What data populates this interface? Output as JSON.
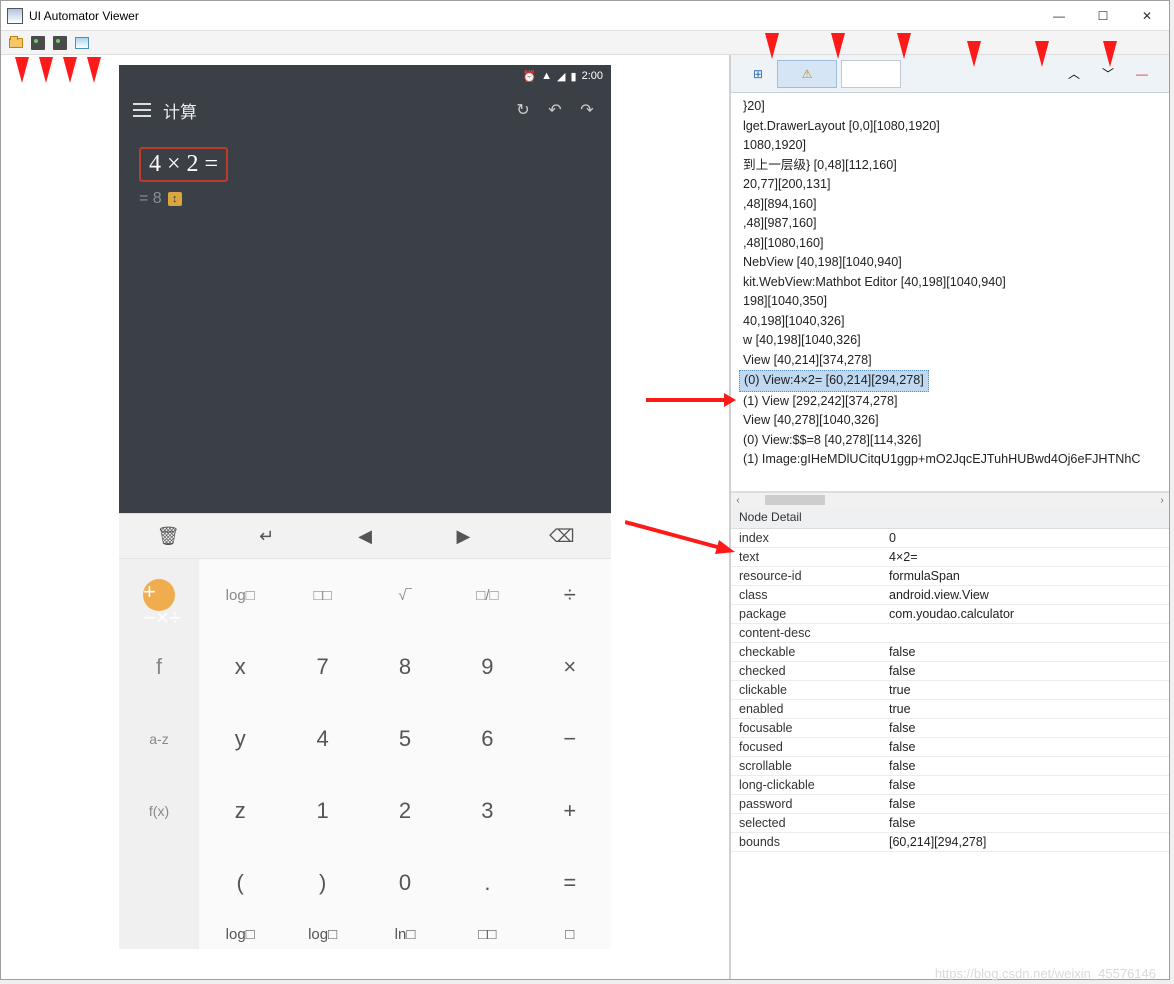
{
  "window": {
    "title": "UI Automator Viewer"
  },
  "status_bar": {
    "time": "2:00"
  },
  "action_bar": {
    "title": "计算"
  },
  "expression": {
    "main": "4 × 2 =",
    "result": "= 8",
    "badge": "↕"
  },
  "fn_row": {
    "trash": "🗑",
    "enter": "↵",
    "left": "◀",
    "right": "▶",
    "back": "⌫"
  },
  "keypad": {
    "r0": {
      "side": "",
      "k1": "log□",
      "k2": "□□",
      "k3": "√‾",
      "k4": "□/□",
      "k5": "÷"
    },
    "r1": {
      "side": "f",
      "k1": "x",
      "k2": "7",
      "k3": "8",
      "k4": "9",
      "k5": "×"
    },
    "r2": {
      "side": "a-z",
      "k1": "y",
      "k2": "4",
      "k3": "5",
      "k4": "6",
      "k5": "−"
    },
    "r3": {
      "side": "f(x)",
      "k1": "z",
      "k2": "1",
      "k3": "2",
      "k4": "3",
      "k5": "+"
    },
    "r4": {
      "side": "",
      "k1": "(",
      "k2": ")",
      "k3": "0",
      "k4": ".",
      "k5": "="
    },
    "r5": {
      "side": "",
      "k1": "log□",
      "k2": "log□",
      "k3": "ln□",
      "k4": "□□",
      "k5": "□"
    }
  },
  "tree_toolbar": {
    "expand": "⊞",
    "flag": "⚠",
    "blank": " ",
    "up": "︿",
    "down": "﹀",
    "minus": "—"
  },
  "tree": [
    "}20]",
    "lget.DrawerLayout [0,0][1080,1920]",
    "1080,1920]",
    "到上一层级} [0,48][112,160]",
    "20,77][200,131]",
    ",48][894,160]",
    ",48][987,160]",
    ",48][1080,160]",
    "NebView [40,198][1040,940]",
    "kit.WebView:Mathbot Editor [40,198][1040,940]",
    "198][1040,350]",
    "40,198][1040,326]",
    "w [40,198][1040,326]",
    "View [40,214][374,278]",
    "(0) View:4×2= [60,214][294,278]",
    "(1) View [292,242][374,278]",
    "View [40,278][1040,326]",
    "(0) View:$$=8 [40,278][114,326]",
    "(1) Image:gIHeMDlUCitqU1ggp+mO2JqcEJTuhHUBwd4Oj6eFJHTNhC"
  ],
  "tree_selected_index": 14,
  "detail_header": "Node Detail",
  "detail": [
    [
      "index",
      "0"
    ],
    [
      "text",
      "4×2="
    ],
    [
      "resource-id",
      "formulaSpan"
    ],
    [
      "class",
      "android.view.View"
    ],
    [
      "package",
      "com.youdao.calculator"
    ],
    [
      "content-desc",
      ""
    ],
    [
      "checkable",
      "false"
    ],
    [
      "checked",
      "false"
    ],
    [
      "clickable",
      "true"
    ],
    [
      "enabled",
      "true"
    ],
    [
      "focusable",
      "false"
    ],
    [
      "focused",
      "false"
    ],
    [
      "scrollable",
      "false"
    ],
    [
      "long-clickable",
      "false"
    ],
    [
      "password",
      "false"
    ],
    [
      "selected",
      "false"
    ],
    [
      "bounds",
      "[60,214][294,278]"
    ]
  ],
  "watermark": "https://blog.csdn.net/weixin_45576146"
}
